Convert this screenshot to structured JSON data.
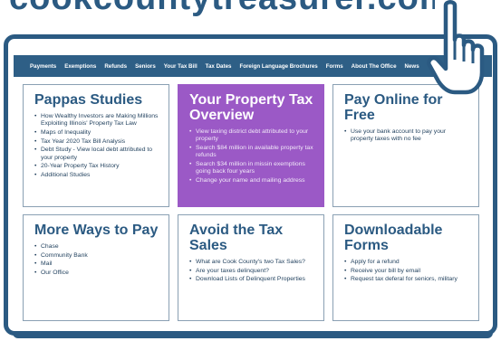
{
  "banner": {
    "url_text": "cookcountytreasurer.com"
  },
  "nav": {
    "items": [
      "Payments",
      "Exemptions",
      "Refunds",
      "Seniors",
      "Your Tax Bill",
      "Tax Dates",
      "Foreign Language Brochures",
      "Forms",
      "About The Office",
      "News"
    ]
  },
  "cards": {
    "pappas": {
      "title": "Pappas Studies",
      "items": [
        "How Wealthy Investors are Making Millions Exploiting Illinois' Property Tax Law",
        "Maps of Inequality",
        "Tax Year 2020 Tax Bill Analysis",
        "Debt Study - View local debt attributed to your property",
        "20-Year Property Tax History",
        "Additional Studies"
      ]
    },
    "overview": {
      "title": "Your Property Tax Overview",
      "items": [
        "View taxing district debt attributed to your property",
        "Search $84 million in available property tax refunds",
        "Search $34 million in missin exemptions going back four years",
        "Change your name and mailing address"
      ]
    },
    "payonline": {
      "title": "Pay Online for Free",
      "items": [
        "Use your bank account to pay your property taxes with no fee"
      ]
    },
    "moreways": {
      "title": "More Ways to Pay",
      "items": [
        "Chase",
        "Community Bank",
        "Mail",
        "Our Office"
      ]
    },
    "avoid": {
      "title": "Avoid the Tax Sales",
      "items": [
        "What are Cook County's two Tax Sales?",
        "Are your taxes delinquent?",
        "Download Lists of Delinquent Properties"
      ]
    },
    "downloadable": {
      "title": "Downloadable Forms",
      "items": [
        "Apply for a refund",
        "Receive your bill by email",
        "Request tax deferal for seniors, military"
      ]
    }
  },
  "colors": {
    "brand_blue": "#2b5a82",
    "nav_bg": "#2e5f86",
    "accent_purple": "#9b59c6"
  },
  "icons": {
    "pointer": "hand-pointer-icon"
  }
}
